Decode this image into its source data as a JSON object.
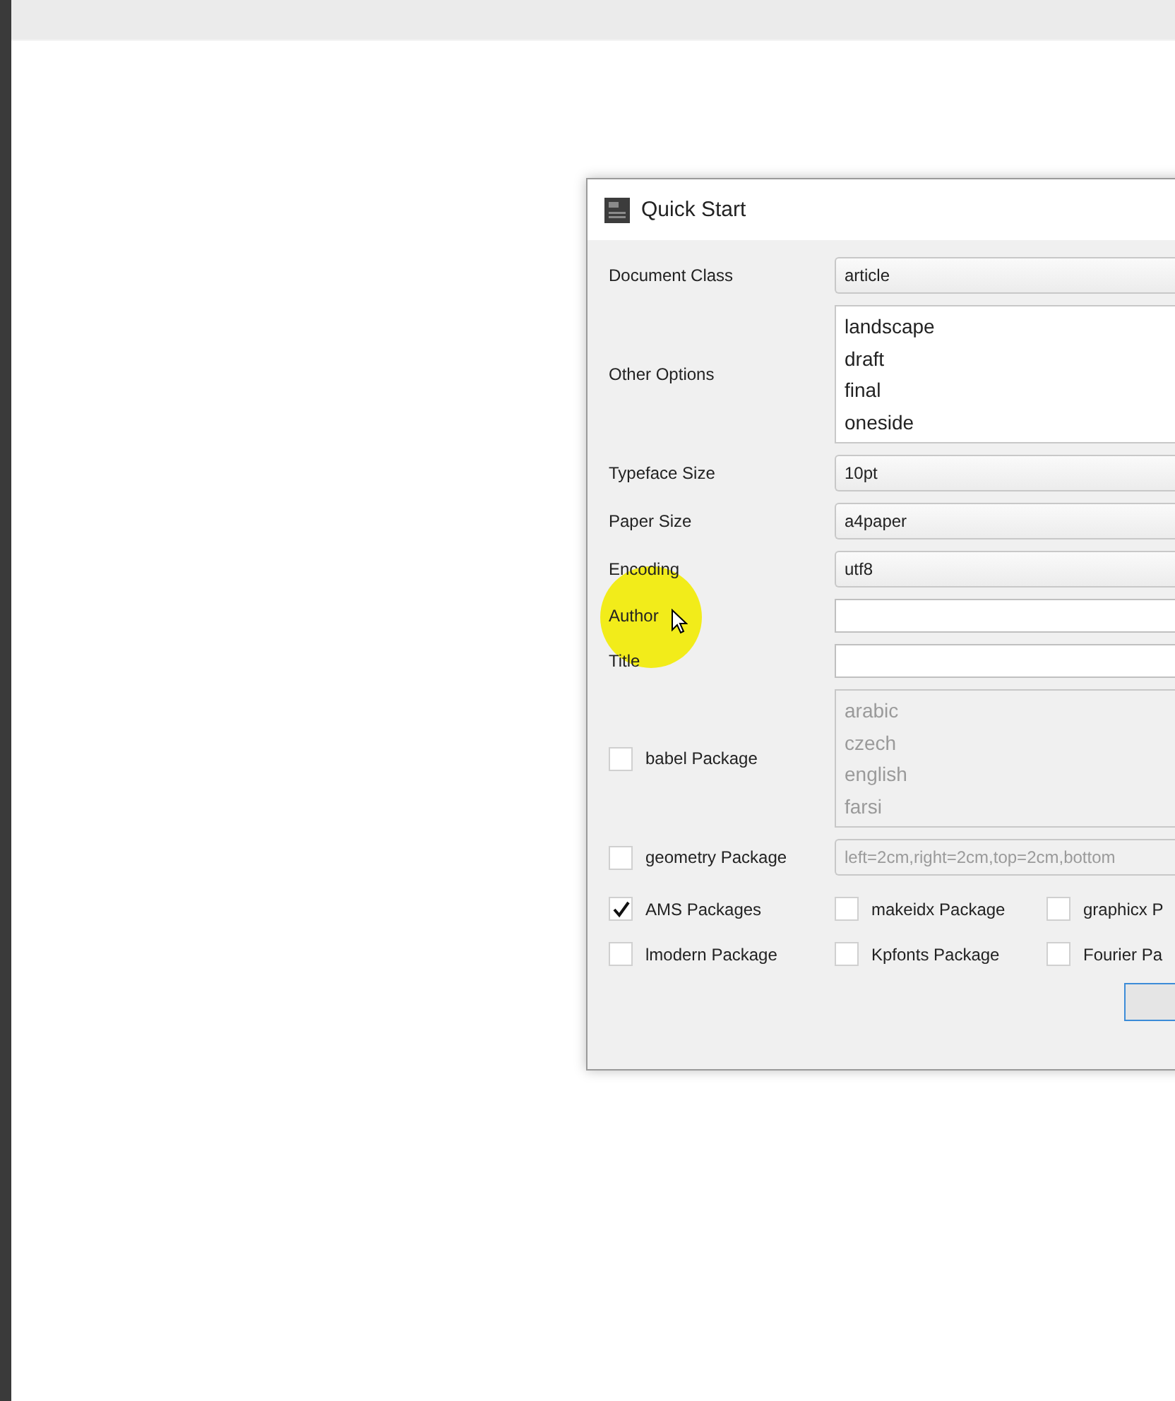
{
  "dialog": {
    "title": "Quick Start",
    "rows": [
      {
        "kind": "combo",
        "label": "Document Class",
        "value": "article"
      },
      {
        "kind": "list",
        "label": "Other Options",
        "items": [
          "landscape",
          "draft",
          "final",
          "oneside"
        ]
      },
      {
        "kind": "combo",
        "label": "Typeface Size",
        "value": "10pt"
      },
      {
        "kind": "combo",
        "label": "Paper Size",
        "value": "a4paper"
      },
      {
        "kind": "combo",
        "label": "Encoding",
        "value": "utf8"
      },
      {
        "kind": "text",
        "label": "Author",
        "value": ""
      },
      {
        "kind": "text",
        "label": "Title",
        "value": ""
      },
      {
        "kind": "checklist",
        "label": "babel Package",
        "checked": false,
        "disabled": true,
        "items": [
          "arabic",
          "czech",
          "english",
          "farsi"
        ]
      },
      {
        "kind": "checkfield",
        "label": "geometry Package",
        "checked": false,
        "disabled": true,
        "value": "left=2cm,right=2cm,top=2cm,bottom"
      }
    ],
    "checkbox_rows": [
      [
        {
          "label": "AMS Packages",
          "checked": true
        },
        {
          "label": "makeidx Package",
          "checked": false
        },
        {
          "label": "graphicx P",
          "checked": false
        }
      ],
      [
        {
          "label": "lmodern Package",
          "checked": false
        },
        {
          "label": "Kpfonts Package",
          "checked": false
        },
        {
          "label": "Fourier Pa",
          "checked": false
        }
      ]
    ]
  }
}
